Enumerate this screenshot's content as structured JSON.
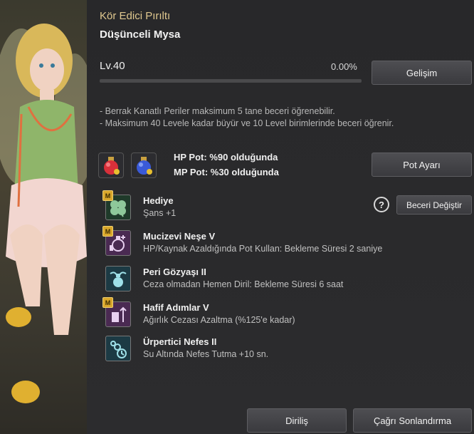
{
  "header": {
    "title": "Kör Edici Pırıltı",
    "name": "Düşünceli Mysa"
  },
  "level": {
    "label": "Lv.40",
    "percent_text": "0.00%",
    "progress": 0
  },
  "buttons": {
    "develop": "Gelişim",
    "pot_settings": "Pot Ayarı",
    "change_skill": "Beceri Değiştir",
    "help": "?",
    "revive": "Diriliş",
    "end_summon": "Çağrı Sonlandırma"
  },
  "notes": [
    "- Berrak Kanatlı Periler maksimum 5 tane beceri öğrenebilir.",
    "- Maksimum 40 Levele kadar büyür ve 10 Level birimlerinde beceri öğrenir."
  ],
  "potions": {
    "hp": "HP Pot: %90 olduğunda",
    "mp": "MP Pot: %30 olduğunda",
    "hp_icon": "red-potion-icon",
    "mp_icon": "blue-potion-icon"
  },
  "skills": [
    {
      "name": "Hediye",
      "desc": "Şans +1",
      "badge": "M",
      "icon": "clover-icon"
    },
    {
      "name": "Mucizevi Neşe V",
      "desc": "HP/Kaynak Azaldığında Pot Kullan: Bekleme Süresi 2 saniye",
      "badge": "M",
      "icon": "potion-plus-icon"
    },
    {
      "name": "Peri Gözyaşı II",
      "desc": "Ceza olmadan Hemen Diril: Bekleme Süresi 6 saat",
      "badge": "",
      "icon": "winged-flask-icon"
    },
    {
      "name": "Hafif Adımlar V",
      "desc": "Ağırlık Cezası Azaltma (%125'e kadar)",
      "badge": "M",
      "icon": "weight-arrow-icon"
    },
    {
      "name": "Ürpertici Nefes II",
      "desc": "Su Altında Nefes Tutma +10 sn.",
      "badge": "",
      "icon": "bubbles-timer-icon"
    }
  ],
  "colors": {
    "title_gold": "#e0c88f",
    "badge_gold": "#d9a72b",
    "panel_bg": "#2c2c2e"
  }
}
